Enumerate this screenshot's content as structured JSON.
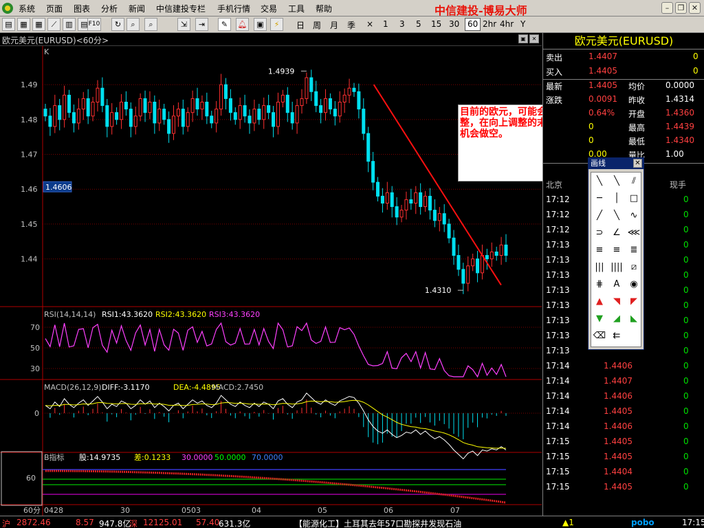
{
  "menu": [
    "系统",
    "页面",
    "图表",
    "分析",
    "新闻",
    "中信建投专栏",
    "手机行情",
    "交易",
    "工具",
    "帮助"
  ],
  "brand": "中信建投-博易大师",
  "periods": [
    "日",
    "周",
    "月",
    "季",
    "×",
    "1",
    "3",
    "5",
    "15",
    "30",
    "60",
    "2hr",
    "4hr",
    "Y"
  ],
  "active_period": "60",
  "chart_title": "欧元美元(EURUSD)<60分>",
  "main_label": "K",
  "price_ticks": [
    "1.49",
    "1.48",
    "1.47",
    "1.46",
    "1.45",
    "1.44"
  ],
  "price_highlight": "1.4606",
  "high_label": "1.4939",
  "low_label": "1.4310",
  "rsi_label": {
    "name": "RSI(14,14,14)",
    "rsi1": "RSI1:43.3620",
    "rsi2": "RSI2:43.3620",
    "rsi3": "RSI3:43.3620"
  },
  "rsi_ticks": [
    "70",
    "50",
    "30"
  ],
  "macd_label": {
    "name": "MACD(26,12,9)",
    "diff": "DIFF:-3.1170",
    "dea": "DEA:-4.4895",
    "macd": "MACD:2.7450"
  },
  "macd_tick": "0",
  "b_label": {
    "name": "B指标",
    "gu": "股:14.9735",
    "cha": "差:0.1233",
    "v30": "30.0000",
    "v50": "50.0000",
    "v70": "70.0000"
  },
  "b_tick": "60",
  "date_axis": {
    "period": "60分",
    "dates": [
      "0428",
      "30",
      "0503",
      "04",
      "05",
      "06",
      "07"
    ]
  },
  "annotation": "目前的欧元，可能会向上调整，在向上调整的末端，找机会做空。",
  "right_title": "欧元美元(EURUSD)",
  "quote": [
    {
      "l": "卖出",
      "v": "1.4407",
      "r": "0"
    },
    {
      "l": "买入",
      "v": "1.4405",
      "r": "0"
    }
  ],
  "quote2": [
    {
      "l": "最新",
      "v": "1.4405",
      "l2": "均价",
      "v2": "0.0000"
    },
    {
      "l": "涨跌",
      "v": "0.0091",
      "l2": "昨收",
      "v2": "1.4314"
    },
    {
      "l": "",
      "v": "0.64%",
      "l2": "开盘",
      "v2": "1.4360"
    },
    {
      "l": "",
      "v": "0",
      "l2": "最高",
      "v2": "1.4439"
    },
    {
      "l": "",
      "v": "0",
      "l2": "最低",
      "v2": "1.4340"
    },
    {
      "l": "",
      "v": "0.00",
      "l2": "量比",
      "v2": "1.00"
    }
  ],
  "ticks_header": {
    "time": "北京",
    "vol": "现手"
  },
  "ticks": [
    {
      "t": "17:12",
      "p": "",
      "v": "0"
    },
    {
      "t": "17:12",
      "p": "",
      "v": "0"
    },
    {
      "t": "17:12",
      "p": "",
      "v": "0"
    },
    {
      "t": "17:13",
      "p": "",
      "v": "0"
    },
    {
      "t": "17:13",
      "p": "",
      "v": "0"
    },
    {
      "t": "17:13",
      "p": "",
      "v": "0"
    },
    {
      "t": "17:13",
      "p": "",
      "v": "0"
    },
    {
      "t": "17:13",
      "p": "",
      "v": "0"
    },
    {
      "t": "17:13",
      "p": "",
      "v": "0"
    },
    {
      "t": "17:13",
      "p": "",
      "v": "0"
    },
    {
      "t": "17:13",
      "p": "",
      "v": "0"
    },
    {
      "t": "17:14",
      "p": "1.4406",
      "v": "0"
    },
    {
      "t": "17:14",
      "p": "1.4407",
      "v": "0"
    },
    {
      "t": "17:14",
      "p": "1.4406",
      "v": "0"
    },
    {
      "t": "17:14",
      "p": "1.4405",
      "v": "0"
    },
    {
      "t": "17:14",
      "p": "1.4406",
      "v": "0"
    },
    {
      "t": "17:15",
      "p": "1.4405",
      "v": "0"
    },
    {
      "t": "17:15",
      "p": "1.4405",
      "v": "0"
    },
    {
      "t": "17:15",
      "p": "1.4404",
      "v": "0"
    },
    {
      "t": "17:15",
      "p": "1.4405",
      "v": "0"
    }
  ],
  "drawtool_title": "画线",
  "status": {
    "sh": "沪",
    "sh_val": "2872.46",
    "sh_chg": "8.57",
    "sh_amt": "947.8亿",
    "sz": "深",
    "sz_val": "12125.01",
    "sz_chg": "57.40",
    "sz_amt": "631.3亿",
    "news": "【能源化工】土耳其去年57口勘探井发现石油",
    "alert": "▲1",
    "pobo": "pobo",
    "time": "17:15"
  },
  "chart_data": {
    "type": "candlestick",
    "title": "欧元美元(EURUSD)<60分>",
    "ylim": [
      1.4265,
      1.4995
    ],
    "yticks": [
      1.49,
      1.48,
      1.47,
      1.46,
      1.45,
      1.44
    ],
    "highlight_price": 1.4606,
    "annotated_high": 1.4939,
    "annotated_low": 1.431,
    "x_labels": [
      "0428",
      "30",
      "0503",
      "04",
      "05",
      "06",
      "07"
    ],
    "close_path": [
      1.481,
      1.478,
      1.484,
      1.48,
      1.487,
      1.482,
      1.479,
      1.483,
      1.486,
      1.481,
      1.485,
      1.489,
      1.484,
      1.478,
      1.482,
      1.48,
      1.485,
      1.483,
      1.478,
      1.481,
      1.486,
      1.482,
      1.485,
      1.479,
      1.483,
      1.48,
      1.476,
      1.481,
      1.483,
      1.478,
      1.482,
      1.486,
      1.483,
      1.485,
      1.481,
      1.479,
      1.483,
      1.49,
      1.486,
      1.482,
      1.48,
      1.484,
      1.481,
      1.479,
      1.483,
      1.48,
      1.484,
      1.482,
      1.478,
      1.485,
      1.487,
      1.482,
      1.479,
      1.484,
      1.486,
      1.492,
      1.488,
      1.484,
      1.482,
      1.486,
      1.483,
      1.481,
      1.485,
      1.487,
      1.489,
      1.488,
      1.483,
      1.476,
      1.468,
      1.462,
      1.458,
      1.456,
      1.459,
      1.455,
      1.452,
      1.454,
      1.457,
      1.456,
      1.459,
      1.455,
      1.458,
      1.454,
      1.451,
      1.453,
      1.45,
      1.446,
      1.441,
      1.437,
      1.433,
      1.438,
      1.44,
      1.436,
      1.441,
      1.44,
      1.442,
      1.441,
      1.444,
      1.441
    ],
    "trendline": {
      "from": [
        0.69,
        1.49
      ],
      "to": [
        0.925,
        1.4325
      ]
    },
    "rsi": {
      "ticks": [
        70,
        50,
        30
      ],
      "series": [
        {
          "name": "RSI1",
          "value": 43.362
        }
      ]
    },
    "macd": {
      "diff": -3.117,
      "dea": -4.4895,
      "macd": 2.745
    },
    "b_indicator": {
      "gu": 14.9735,
      "cha": 0.1233,
      "levels": [
        30,
        50,
        70
      ]
    }
  }
}
